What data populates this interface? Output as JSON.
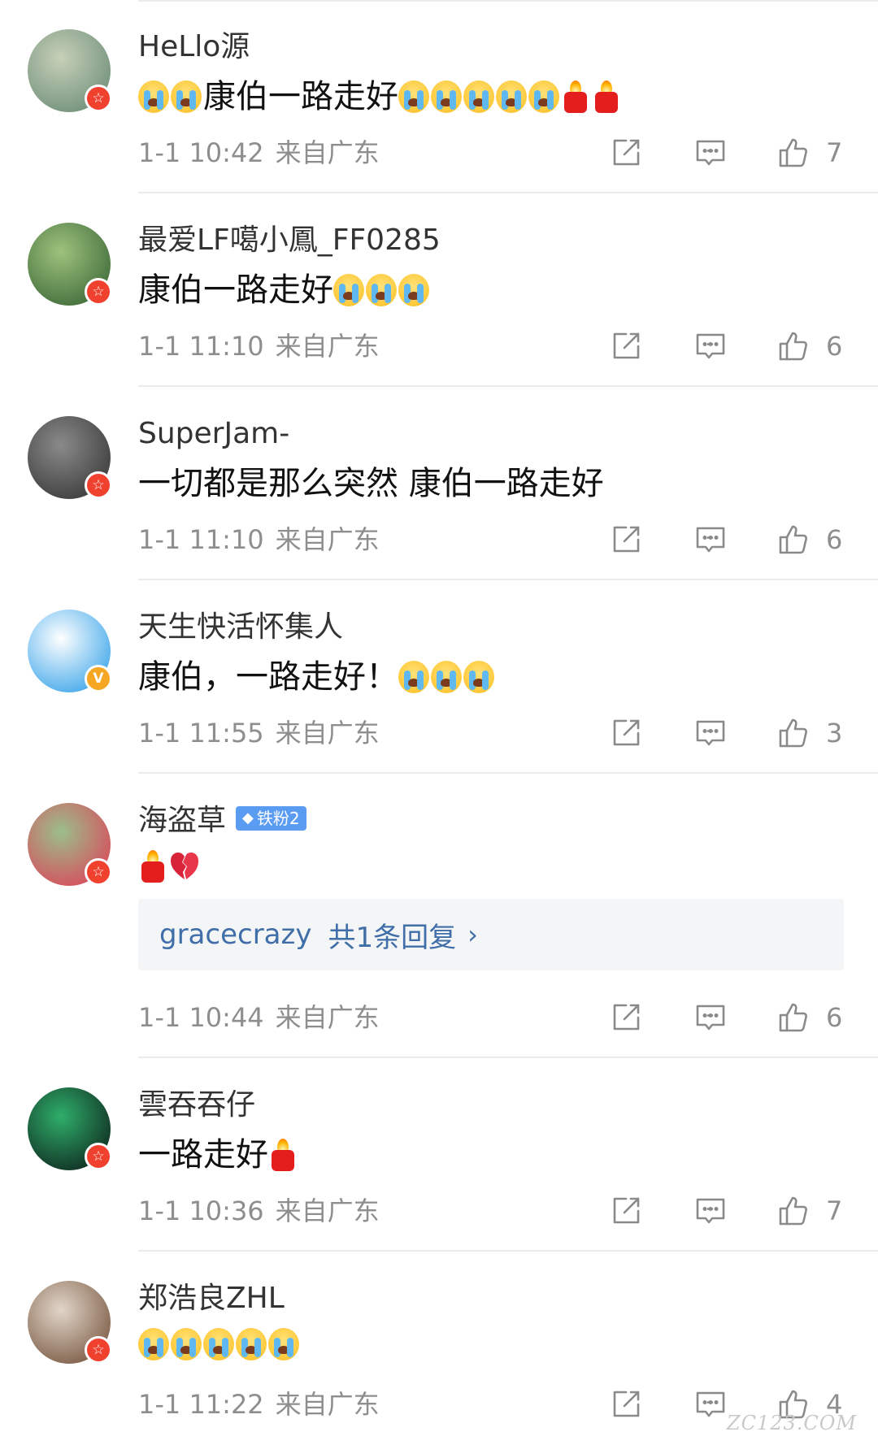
{
  "comments": [
    {
      "username": "HeLlo源",
      "badge": "red",
      "text_before": "",
      "text": "康伯一路走好",
      "emojis_before": [
        "cry",
        "cry"
      ],
      "emojis_after": [
        "cry",
        "cry",
        "cry",
        "cry",
        "cry",
        "candle",
        "candle"
      ],
      "time": "1-1 10:42",
      "location": "来自广东",
      "likes": "7",
      "avatar_colors": [
        "#6f8f7a",
        "#c7d0b8"
      ]
    },
    {
      "username": "最爱LF噶小鳳_FF0285",
      "badge": "red",
      "text": "康伯一路走好",
      "emojis_before": [],
      "emojis_after": [
        "cry",
        "cry",
        "cry"
      ],
      "time": "1-1 11:10",
      "location": "来自广东",
      "likes": "6",
      "avatar_colors": [
        "#3f6b3a",
        "#9ec27d"
      ]
    },
    {
      "username": "SuperJam-",
      "badge": "red",
      "text": "一切都是那么突然 康伯一路走好",
      "emojis_before": [],
      "emojis_after": [],
      "time": "1-1 11:10",
      "location": "来自广东",
      "likes": "6",
      "avatar_colors": [
        "#3b3b3b",
        "#8a8a8a"
      ]
    },
    {
      "username": "天生快活怀集人",
      "badge": "gold",
      "badge_symbol": "V",
      "text": "康伯，一路走好！",
      "emojis_before": [],
      "emojis_after": [
        "cry",
        "cry",
        "cry"
      ],
      "time": "1-1 11:55",
      "location": "来自广东",
      "likes": "3",
      "avatar_colors": [
        "#3ea6ea",
        "#ffffff"
      ]
    },
    {
      "username": "海盗草",
      "fan_badge": "铁粉2",
      "badge": "red",
      "text": "",
      "emojis_before": [
        "candle",
        "heart"
      ],
      "emojis_after": [],
      "reply": {
        "user": "gracecrazy",
        "count": "共1条回复",
        "chevron": "›"
      },
      "time": "1-1 10:44",
      "location": "来自广东",
      "likes": "6",
      "avatar_colors": [
        "#d94a5a",
        "#9bbf8c"
      ]
    },
    {
      "username": "雲吞吞仔",
      "badge": "red",
      "text": "一路走好",
      "emojis_before": [],
      "emojis_after": [
        "candle"
      ],
      "time": "1-1 10:36",
      "location": "来自广东",
      "likes": "7",
      "avatar_colors": [
        "#0f2a20",
        "#2fae6a"
      ]
    },
    {
      "username": "郑浩良ZHL",
      "badge": "red",
      "text": "",
      "emojis_before": [
        "cry",
        "cry",
        "cry",
        "cry",
        "cry"
      ],
      "emojis_after": [],
      "time": "1-1 11:22",
      "location": "来自广东",
      "likes": "4",
      "avatar_colors": [
        "#7b5a44",
        "#e1d6c9"
      ]
    }
  ],
  "watermark": "ZC123.COM",
  "icons": {
    "share": "share-icon",
    "reply": "comment-icon",
    "like": "thumbs-up-icon",
    "badge": "verified-star-icon"
  }
}
